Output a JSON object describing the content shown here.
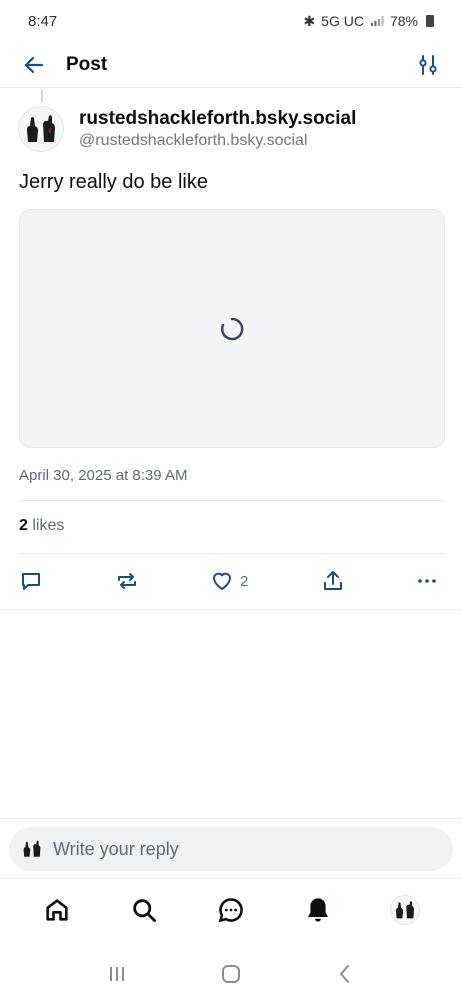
{
  "status_bar": {
    "time": "8:47",
    "network": "5G UC",
    "battery": "78%"
  },
  "header": {
    "title": "Post"
  },
  "post": {
    "display_name": "rustedshackleforth.bsky.social",
    "handle": "@rustedshackleforth.bsky.social",
    "text": "Jerry really do be like",
    "timestamp": "April 30, 2025 at 8:39 AM",
    "likes_count": "2",
    "likes_label": "likes",
    "like_action_count": "2"
  },
  "reply": {
    "placeholder": "Write your reply"
  },
  "tabs": [
    "home-tab",
    "search-tab",
    "chat-tab",
    "notifications-tab",
    "profile-tab"
  ],
  "colors": {
    "accent": "#1083fe",
    "muted": "#5b6b7c",
    "divider": "#e6e9ed"
  }
}
